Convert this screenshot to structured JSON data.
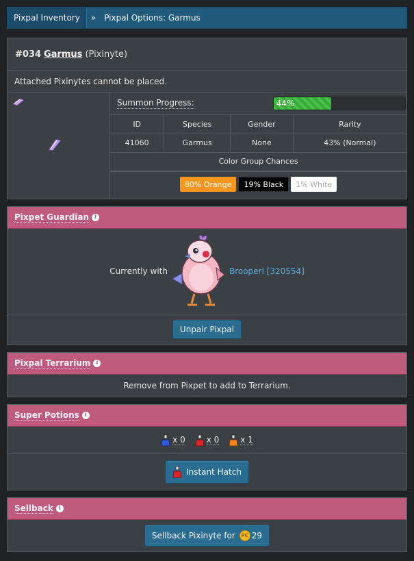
{
  "breadcrumb": {
    "home": "Pixpal Inventory",
    "separator": "»",
    "current": "Pixpal Options: Garmus"
  },
  "pixpal": {
    "number": "#034",
    "name": "Garmus",
    "type": "(Pixinyte)",
    "note": "Attached Pixinytes cannot be placed."
  },
  "summon": {
    "label": "Summon Progress:",
    "percent": 44,
    "percent_text": "44%"
  },
  "stats": {
    "headers": [
      "ID",
      "Species",
      "Gender",
      "Rarity"
    ],
    "values": [
      "41060",
      "Garmus",
      "None",
      "43% (Normal)"
    ]
  },
  "color_chances": {
    "title": "Color Group Chances",
    "chips": [
      "80% Orange",
      "19% Black",
      "1% White"
    ]
  },
  "guardian": {
    "title": "Pixpet Guardian",
    "with_label": "Currently with",
    "pet_link": "Brooperi [320554]",
    "unpair_button": "Unpair Pixpal"
  },
  "terrarium": {
    "title": "Pixpal Terrarium",
    "message": "Remove from Pixpet to add to Terrarium."
  },
  "potions": {
    "title": "Super Potions",
    "items": [
      {
        "color": "#2e5bd9",
        "count": "x 0"
      },
      {
        "color": "#d9262e",
        "count": "x 0"
      },
      {
        "color": "#f0841e",
        "count": "x 1"
      }
    ],
    "instant_hatch": "Instant Hatch"
  },
  "sellback": {
    "title": "Sellback",
    "button": "Sellback Pixinyte for",
    "coin_label": "PC",
    "amount": "29"
  },
  "colors": {
    "accent_pink": "#bf5a7d",
    "button_blue": "#2b6c91",
    "progress_green": "#46c246"
  }
}
